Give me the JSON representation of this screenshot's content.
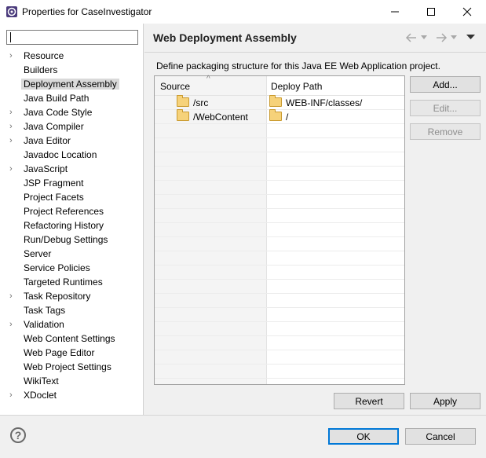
{
  "window": {
    "title": "Properties for CaseInvestigator"
  },
  "filter": {
    "value": "",
    "placeholder": ""
  },
  "tree": [
    {
      "label": "Resource",
      "expandable": true
    },
    {
      "label": "Builders",
      "expandable": false
    },
    {
      "label": "Deployment Assembly",
      "expandable": false,
      "selected": true
    },
    {
      "label": "Java Build Path",
      "expandable": false
    },
    {
      "label": "Java Code Style",
      "expandable": true
    },
    {
      "label": "Java Compiler",
      "expandable": true
    },
    {
      "label": "Java Editor",
      "expandable": true
    },
    {
      "label": "Javadoc Location",
      "expandable": false
    },
    {
      "label": "JavaScript",
      "expandable": true
    },
    {
      "label": "JSP Fragment",
      "expandable": false
    },
    {
      "label": "Project Facets",
      "expandable": false
    },
    {
      "label": "Project References",
      "expandable": false
    },
    {
      "label": "Refactoring History",
      "expandable": false
    },
    {
      "label": "Run/Debug Settings",
      "expandable": false
    },
    {
      "label": "Server",
      "expandable": false
    },
    {
      "label": "Service Policies",
      "expandable": false
    },
    {
      "label": "Targeted Runtimes",
      "expandable": false
    },
    {
      "label": "Task Repository",
      "expandable": true
    },
    {
      "label": "Task Tags",
      "expandable": false
    },
    {
      "label": "Validation",
      "expandable": true
    },
    {
      "label": "Web Content Settings",
      "expandable": false
    },
    {
      "label": "Web Page Editor",
      "expandable": false
    },
    {
      "label": "Web Project Settings",
      "expandable": false
    },
    {
      "label": "WikiText",
      "expandable": false
    },
    {
      "label": "XDoclet",
      "expandable": true
    }
  ],
  "page": {
    "title": "Web Deployment Assembly",
    "description": "Define packaging structure for this Java EE Web Application project."
  },
  "table": {
    "columns": [
      "Source",
      "Deploy Path"
    ],
    "rows": [
      {
        "source": "/src",
        "deploy": "WEB-INF/classes/"
      },
      {
        "source": "/WebContent",
        "deploy": "/"
      }
    ]
  },
  "buttons": {
    "add": "Add...",
    "edit": "Edit...",
    "remove": "Remove",
    "revert": "Revert",
    "apply": "Apply",
    "ok": "OK",
    "cancel": "Cancel"
  },
  "icons": {
    "help": "?",
    "minimize": "—",
    "maximize": "☐",
    "close": "✕"
  },
  "colors": {
    "accent": "#0078d7",
    "selection": "#d9d9d9"
  }
}
